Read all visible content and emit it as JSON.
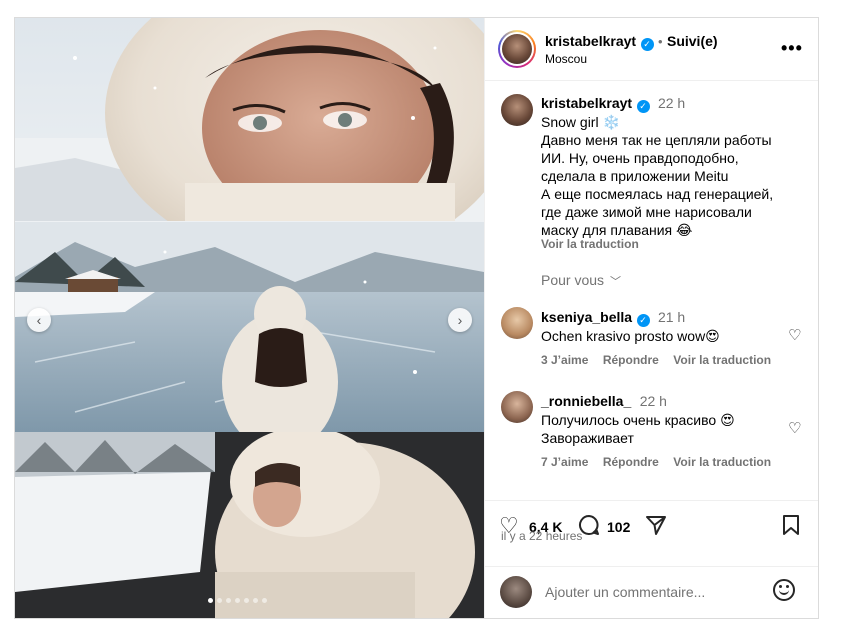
{
  "post": {
    "author": {
      "username": "kristabelkrayt",
      "separator": "•",
      "follow_status": "Suivi(e)",
      "location": "Moscou",
      "more_icon": "more-horizontal-icon"
    },
    "caption": {
      "username": "kristabelkrayt",
      "time": "22 h",
      "lines": [
        "Snow girl ❄️",
        "Давно меня так не цепляли работы",
        "ИИ. Ну, очень правдоподобно,",
        "сделала в приложении Meitu",
        "А еще посмеялась над генерацией,",
        "где даже зимой мне нарисовали",
        "маску для плавания 😂"
      ],
      "translate": "Voir la traduction"
    },
    "for_you": "Pour vous",
    "comments": [
      {
        "username": "kseniya_bella",
        "verified": true,
        "time": "21 h",
        "lines": [
          "Ochen krasivo prosto wow😍"
        ],
        "likes": "3 J’aime",
        "reply": "Répondre",
        "translate": "Voir la traduction"
      },
      {
        "username": "_ronniebella_",
        "verified": false,
        "time": "22 h",
        "lines": [
          "Получилось очень красиво 😍",
          "Завораживает"
        ],
        "likes": "7 J’aime",
        "reply": "Répondre",
        "translate": "Voir la traduction"
      }
    ],
    "actions": {
      "like_count": "6,4 K",
      "comment_count": "102",
      "posted_ago": "il y a 22 heures"
    },
    "add_comment": {
      "placeholder": "Ajouter un commentaire..."
    },
    "carousel": {
      "slide_count": 7,
      "active_index": 0
    }
  }
}
